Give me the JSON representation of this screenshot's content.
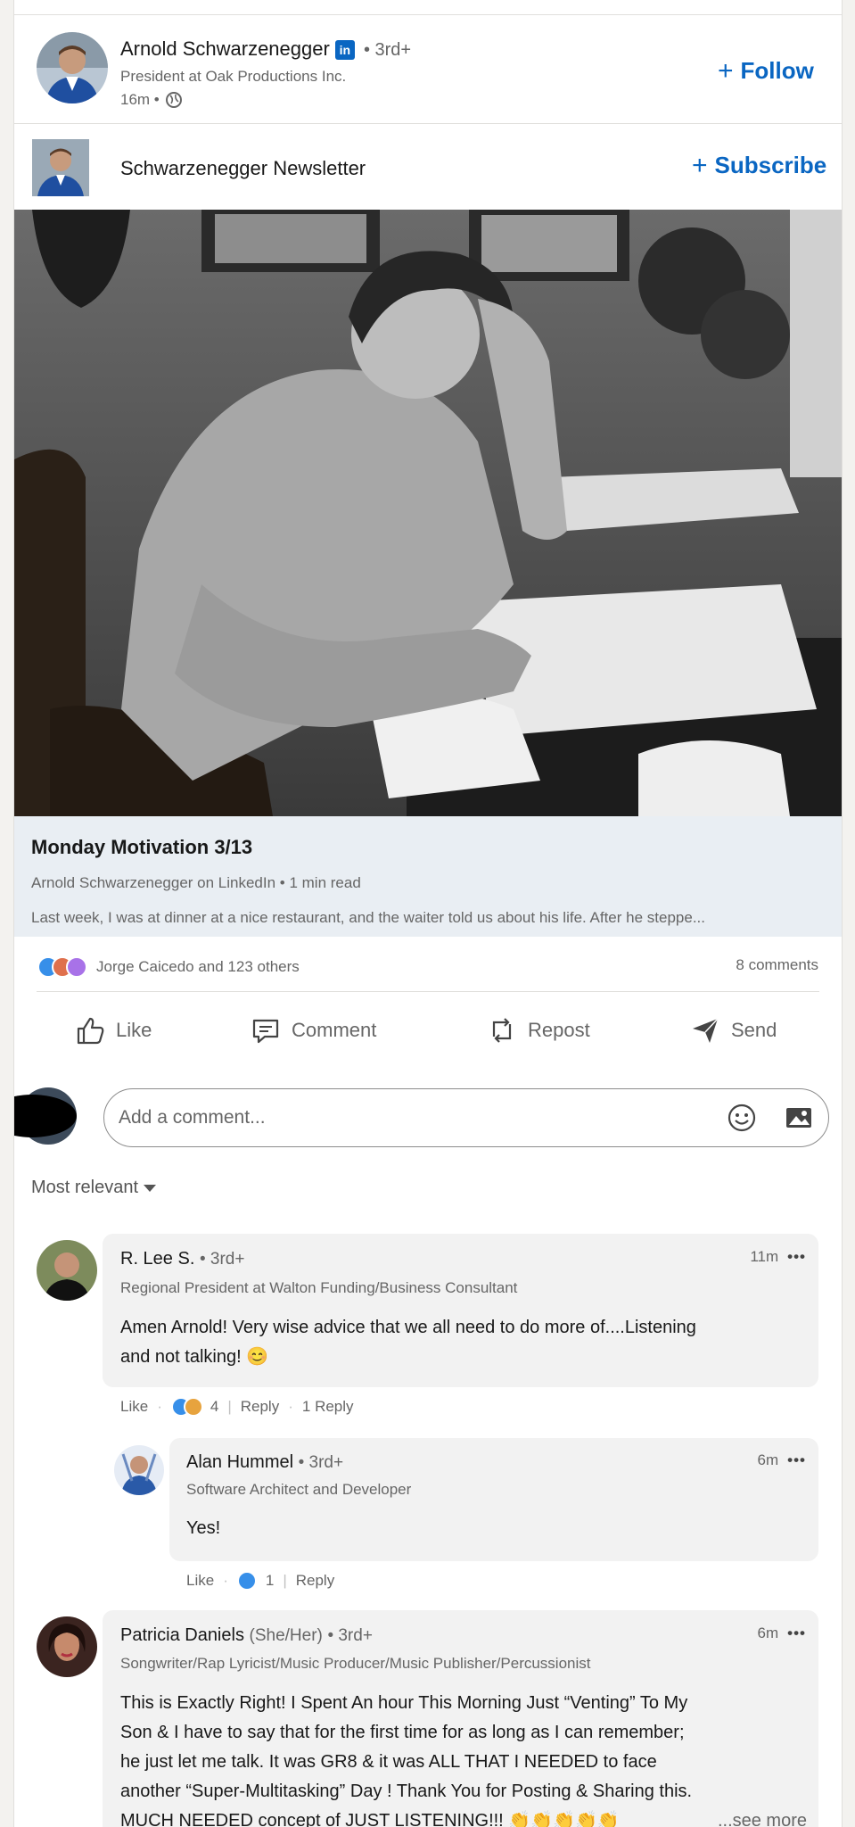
{
  "post": {
    "author_name": "Arnold Schwarzenegger",
    "linkedin_badge": "in",
    "degree": "• 3rd+",
    "headline": "President at Oak Productions Inc.",
    "time": "16m •",
    "follow_label": "Follow",
    "newsletter_name": "Schwarzenegger Newsletter",
    "subscribe_label": "Subscribe"
  },
  "article": {
    "title": "Monday Motivation 3/13",
    "byline": "Arnold Schwarzenegger on LinkedIn • 1 min read",
    "snippet": "Last week, I was at dinner at a nice restaurant, and the waiter told us about his life. After he steppe..."
  },
  "social": {
    "reactions_text": "Jorge Caicedo and 123 others",
    "comments_text": "8 comments"
  },
  "actions": {
    "like": "Like",
    "comment": "Comment",
    "repost": "Repost",
    "send": "Send"
  },
  "comment_input": {
    "placeholder": "Add a comment..."
  },
  "sort_label": "Most relevant",
  "comments": [
    {
      "name": "R. Lee S.",
      "degree": "• 3rd+",
      "headline": "Regional President at Walton Funding/Business Consultant",
      "time": "11m",
      "text_line1": "Amen Arnold! Very wise advice that we all need to do more of....Listening",
      "text_line2": "and not talking! 😊",
      "like": "Like",
      "reaction_count": "4",
      "reply": "Reply",
      "replies": "1 Reply"
    },
    {
      "name": "Alan Hummel",
      "degree": "• 3rd+",
      "headline": "Software Architect and Developer",
      "time": "6m",
      "text": "Yes!",
      "like": "Like",
      "reaction_count": "1",
      "reply": "Reply"
    },
    {
      "name": "Patricia Daniels",
      "pronouns": "(She/Her)",
      "degree": "• 3rd+",
      "headline": "Songwriter/Rap Lyricist/Music Producer/Music Publisher/Percussionist",
      "time": "6m",
      "text_line1": "This is Exactly Right! I Spent An hour This Morning Just “Venting” To My",
      "text_line2": "Son & I have to say that for the first time for as long as I can remember;",
      "text_line3": "he just let me talk. It was GR8 & it was ALL THAT I NEEDED to face",
      "text_line4": "another “Super-Multitasking” Day ! Thank You for Posting & Sharing this.",
      "text_line5": "MUCH NEEDED concept of JUST LISTENING!!! 👏👏👏👏👏",
      "see_more": "...see more"
    }
  ],
  "colors": {
    "brand": "#0a66c2",
    "page_bg": "#f3f2ef",
    "comment_bg": "#f2f2f2",
    "article_meta_bg": "#e9eef3"
  }
}
